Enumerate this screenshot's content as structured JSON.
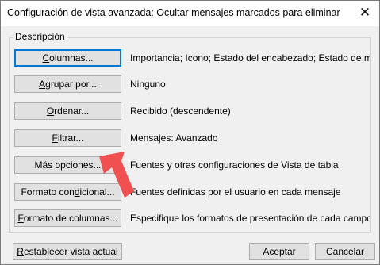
{
  "dialog": {
    "title": "Configuración de vista avanzada: Ocultar mensajes marcados para eliminar",
    "close_label": "✕"
  },
  "group": {
    "label": "Descripción"
  },
  "rows": [
    {
      "label_pre": "",
      "label_u": "C",
      "label_post": "olumnas...",
      "description": "Importancia; Icono; Estado del encabezado; Estado de m..."
    },
    {
      "label_pre": "",
      "label_u": "A",
      "label_post": "grupar por...",
      "description": "Ninguno"
    },
    {
      "label_pre": "",
      "label_u": "O",
      "label_post": "rdenar...",
      "description": "Recibido (descendente)"
    },
    {
      "label_pre": "",
      "label_u": "F",
      "label_post": "iltrar...",
      "description": "Mensajes: Avanzado"
    },
    {
      "label_pre": "Más opciones...",
      "label_u": "",
      "label_post": "",
      "description": "Fuentes y otras configuraciones de Vista de tabla"
    },
    {
      "label_pre": "Formato con",
      "label_u": "d",
      "label_post": "icional...",
      "description": "Fuentes definidas por el usuario en cada mensaje"
    },
    {
      "label_pre": "",
      "label_u": "F",
      "label_post": "ormato de columnas...",
      "description": "Especifique los formatos de presentación de cada campo"
    }
  ],
  "footer": {
    "reset_u": "R",
    "reset_post": "establecer vista actual",
    "accept_label": "Aceptar",
    "cancel_label": "Cancelar"
  },
  "colors": {
    "arrow": "#f0504f",
    "focus": "#0078d7"
  }
}
